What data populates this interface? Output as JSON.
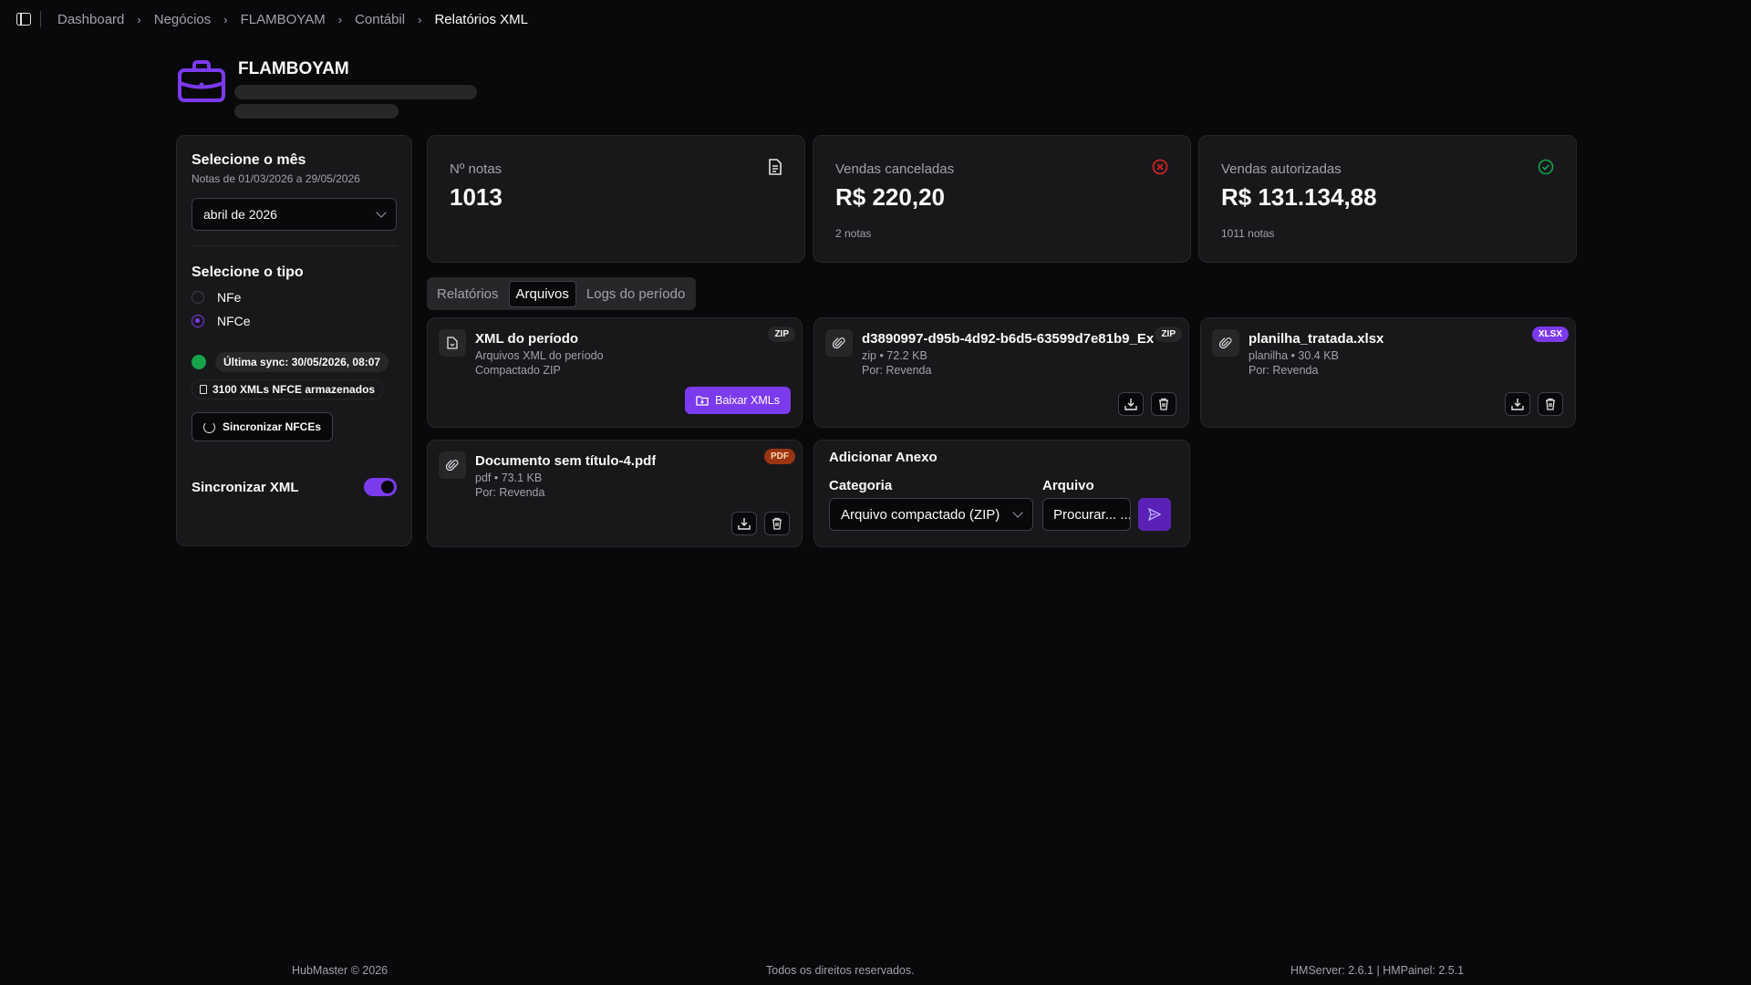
{
  "breadcrumb": [
    "Dashboard",
    "Negócios",
    "FLAMBOYAM",
    "Contábil",
    "Relatórios XML"
  ],
  "company": {
    "name": "FLAMBOYAM"
  },
  "filters": {
    "month_title": "Selecione o mês",
    "month_range": "Notas de 01/03/2026 a 29/05/2026",
    "month_selected": "abril de 2026",
    "type_title": "Selecione o tipo",
    "types": [
      {
        "label": "NFe",
        "selected": false
      },
      {
        "label": "NFCe",
        "selected": true
      }
    ],
    "last_sync": "Última sync: 30/05/2026, 08:07",
    "stored": "3100 XMLs NFCE armazenados",
    "sync_button": "Sincronizar NFCEs",
    "sync_xml_label": "Sincronizar XML",
    "sync_xml_on": true
  },
  "stats": [
    {
      "label": "Nº notas",
      "value": "1013",
      "sub": "",
      "icon": "document-icon"
    },
    {
      "label": "Vendas canceladas",
      "value": "R$ 220,20",
      "sub": "2 notas",
      "icon": "x-circle-icon",
      "color": "#dc2626"
    },
    {
      "label": "Vendas autorizadas",
      "value": "R$ 131.134,88",
      "sub": "1011 notas",
      "icon": "check-circle-icon",
      "color": "#16a34a"
    }
  ],
  "tabs": [
    {
      "label": "Relatórios",
      "active": false
    },
    {
      "label": "Arquivos",
      "active": true
    },
    {
      "label": "Logs do período",
      "active": false
    }
  ],
  "files": [
    {
      "name": "XML do período",
      "meta1": "Arquivos XML do período",
      "meta2": "Compactado ZIP",
      "badge": "ZIP",
      "action": "Baixar XMLs"
    },
    {
      "name": "d3890997-d95b-4d92-b6d5-63599d7e81b9_Ex",
      "meta1": "zip • 72.2 KB",
      "meta2": "Por: Revenda",
      "badge": "ZIP"
    },
    {
      "name": "planilha_tratada.xlsx",
      "meta1": "planilha • 30.4 KB",
      "meta2": "Por: Revenda",
      "badge": "XLSX"
    },
    {
      "name": "Documento sem título-4.pdf",
      "meta1": "pdf • 73.1 KB",
      "meta2": "Por: Revenda",
      "badge": "PDF"
    }
  ],
  "attachment": {
    "title": "Adicionar Anexo",
    "category_label": "Categoria",
    "category_value": "Arquivo compactado (ZIP)",
    "file_label": "Arquivo",
    "file_button": "Procurar... ..."
  },
  "footer": {
    "left": "HubMaster © 2026",
    "center": "Todos os direitos reservados.",
    "right": "HMServer: 2.6.1 | HMPainel: 2.5.1"
  },
  "colors": {
    "accent": "#7c3aed",
    "background": "#09090b",
    "card": "#18181b"
  }
}
